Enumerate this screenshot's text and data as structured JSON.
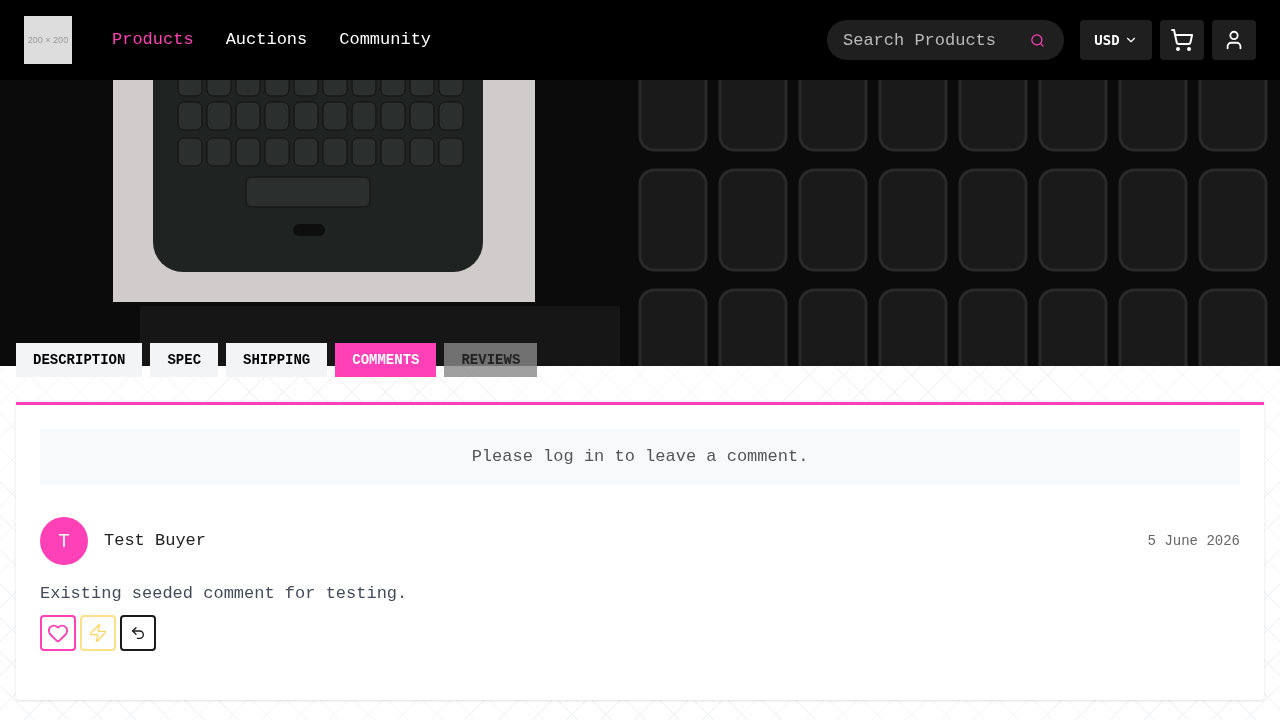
{
  "header": {
    "logo": "200 × 200",
    "nav": [
      {
        "label": "Products",
        "selected": true
      },
      {
        "label": "Auctions",
        "selected": false
      },
      {
        "label": "Community",
        "selected": false
      }
    ],
    "search": {
      "placeholder": "Search Products"
    },
    "currency": "USD"
  },
  "tabs": [
    {
      "label": "DESCRIPTION",
      "selected": false,
      "disabled": false
    },
    {
      "label": "SPEC",
      "selected": false,
      "disabled": false
    },
    {
      "label": "SHIPPING",
      "selected": false,
      "disabled": false
    },
    {
      "label": "COMMENTS",
      "selected": true,
      "disabled": false
    },
    {
      "label": "REVIEWS",
      "selected": false,
      "disabled": true
    }
  ],
  "comments_panel": {
    "login_notice": "Please log in to leave a comment.",
    "comments": [
      {
        "avatar": "T",
        "author": "Test Buyer",
        "date": "5 June 2026",
        "text": "Existing seeded comment for testing.",
        "actions": [
          {
            "kind": "like"
          },
          {
            "kind": "boost"
          },
          {
            "kind": "reply"
          }
        ]
      }
    ]
  }
}
